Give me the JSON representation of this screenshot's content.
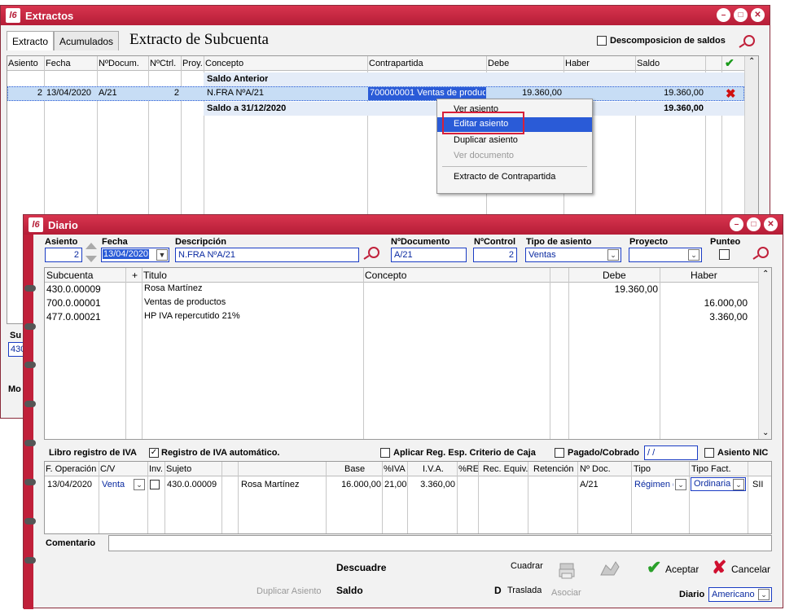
{
  "extractos": {
    "title": "Extractos",
    "logo": "l6",
    "tabs": [
      {
        "label": "Extracto"
      },
      {
        "label": "Acumulados"
      }
    ],
    "heading": "Extracto de Subcuenta",
    "descomposicion_label": "Descomposicion de saldos",
    "columns": [
      "Asiento",
      "Fecha",
      "NºDocum.",
      "NºCtrl.",
      "Proy.",
      "Concepto",
      "Contrapartida",
      "Debe",
      "Haber",
      "Saldo"
    ],
    "saldo_anterior": "Saldo Anterior",
    "row": {
      "asiento": "2",
      "fecha": "13/04/2020",
      "docum": "A/21",
      "ctrl": "2",
      "concepto": "N.FRA NºA/21",
      "contrapartida": "700000001 Ventas de productos",
      "debe": "19.360,00",
      "saldo": "19.360,00"
    },
    "saldo_final_label": "Saldo a 31/12/2020",
    "saldo_final": "19.360,00",
    "left_fragments": {
      "su": "Su",
      "val": "430",
      "mo": "Mo"
    }
  },
  "context_menu": {
    "items": [
      {
        "label": "Ver asiento",
        "disabled": false
      },
      {
        "label": "Editar asiento",
        "highlighted": true
      },
      {
        "label": "Duplicar asiento",
        "disabled": false
      },
      {
        "label": "Ver documento",
        "disabled": true
      },
      {
        "label": "Extracto de Contrapartida",
        "disabled": false
      }
    ]
  },
  "diario": {
    "title": "Diario",
    "logo": "l6",
    "header_labels": {
      "asiento": "Asiento",
      "fecha": "Fecha",
      "descripcion": "Descripción",
      "documento": "NºDocumento",
      "control": "NºControl",
      "tipo": "Tipo de asiento",
      "proyecto": "Proyecto",
      "punteo": "Punteo"
    },
    "header_values": {
      "asiento": "2",
      "fecha": "13/04/2020",
      "descripcion": "N.FRA NºA/21",
      "documento": "A/21",
      "control": "2",
      "tipo": "Ventas",
      "proyecto": ""
    },
    "lines_columns": {
      "subcuenta": "Subcuenta",
      "plus": "+",
      "titulo": "Titulo",
      "concepto": "Concepto",
      "debe": "Debe",
      "haber": "Haber"
    },
    "lines": [
      {
        "subcuenta": "430.0.00009",
        "titulo": "Rosa Martínez",
        "debe": "19.360,00",
        "haber": ""
      },
      {
        "subcuenta": "700.0.00001",
        "titulo": "Ventas de productos",
        "debe": "",
        "haber": "16.000,00"
      },
      {
        "subcuenta": "477.0.00021",
        "titulo": "HP IVA repercutido 21%",
        "debe": "",
        "haber": "3.360,00"
      }
    ],
    "iva_bar": {
      "libro": "Libro registro de IVA",
      "registro": "Registro de IVA automático.",
      "aplicar": "Aplicar Reg. Esp. Criterio de Caja",
      "pagado": "Pagado/Cobrado",
      "pagado_value": " / /",
      "nic": "Asiento NIC"
    },
    "iva_columns": [
      "F. Operación",
      "C/V",
      "Inv.",
      "Sujeto",
      "",
      "Base",
      "%IVA",
      "I.V.A.",
      "%RE",
      "Rec. Equiv.",
      "Retención",
      "Nº Doc.",
      "Tipo",
      "Tipo Fact."
    ],
    "iva_row": {
      "fecha": "13/04/2020",
      "cv": "Venta",
      "sujeto": "430.0.00009",
      "nombre": "Rosa Martínez",
      "base": "16.000,00",
      "iva_pct": "21,00",
      "iva": "3.360,00",
      "doc": "A/21",
      "tipo": "Régimen g",
      "tipo_fact": "Ordinaria",
      "extra": "SII"
    },
    "comentario_label": "Comentario",
    "footer": {
      "descuadre": "Descuadre",
      "saldo": "Saldo",
      "d": "D",
      "cuadrar": "Cuadrar",
      "traslada": "Traslada",
      "asociar": "Asociar",
      "duplicar": "Duplicar Asiento",
      "aceptar": "Aceptar",
      "cancelar": "Cancelar",
      "diario_label": "Diario",
      "diario_value": "Americano"
    }
  }
}
